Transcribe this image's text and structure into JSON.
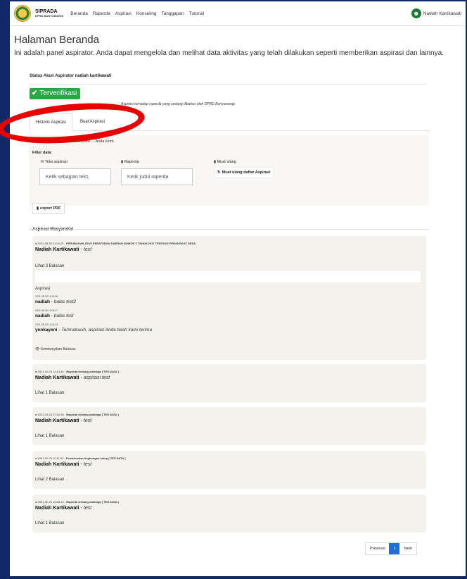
{
  "navbar": {
    "brand_title": "SIPRADA",
    "brand_sub": "DPRD BANYUWANGI",
    "menu": [
      "Beranda",
      "Raperda",
      "Aspirasi",
      "Konseling",
      "Tanggapan",
      "Tutorial"
    ],
    "user_name": "Nadiah Kartikawati"
  },
  "page": {
    "title": "Halaman Beranda",
    "description": "Ini adalah panel aspirator. Anda dapat mengelola dan melihat data aktivitas yang telah dilakukan seperti memberikan aspirasi dan lainnya."
  },
  "status": {
    "line": "Status Akun Aspirator nadiah kartikawati",
    "badge": "Terverifikasi",
    "note": "Aspirasi terhadap raperda yang sedang dibahas oleh DPRD Banyuwangi."
  },
  "tabs": [
    "Historis Aspirasi",
    "Buat Aspirasi"
  ],
  "filter": {
    "info": "ℹ Anda dapat mengelola informasi ... Anda kirim.",
    "title": "Filter data:",
    "text_label": "Teks aspirasi",
    "text_placeholder": "Ketik sebagian teks",
    "raperda_label": "Raperda",
    "raperda_placeholder": "Ketik judul raperda",
    "reload_label": "Muat ulang",
    "reload_button": "Muat ulang daftar Aspirasi"
  },
  "export_label": "export PDF",
  "list_title": "Aspirasi Masyarakat",
  "aspirations": [
    {
      "date": "2021-08-30 11:04:23",
      "topic": "PERUBAHAN ATAS PERATURAN DAERAH NOMOR 3 TAHUN 2017 TENTANG PERANGKAT DESA",
      "name": "Nadiah Kartikawati",
      "text": "test",
      "replies_link": "Lihat 3 Balasan"
    },
    {
      "date": "2021-04-29 14:14:40",
      "topic": "Raperda tentang olahraga [ TES DATA ]",
      "name": "Nadiah Kartikawati",
      "text": "aspirasi test",
      "replies_link": "Lihat 1 Balasan"
    },
    {
      "date": "2021-03-24 07:54:36",
      "topic": "Raperda tentang olahraga [ TES DATA ]",
      "name": "Nadiah Kartikawati",
      "text": "test",
      "replies_link": "Lihat 1 Balasan"
    },
    {
      "date": "2021-02-25 10:11:52",
      "topic": "Pembenahan lingkungan hidup [ TES DATA ]",
      "name": "Nadiah Kartikawati",
      "text": "test",
      "replies_link": "Lihat 2 Balasan"
    },
    {
      "date": "2021-02-25 10:08:14",
      "topic": "Raperda tentang olahraga [ TES DATA ]",
      "name": "Nadiah Kartikawati",
      "text": "test",
      "replies_link": "Lihat 1 Balasan"
    }
  ],
  "replies": {
    "title": "Aspirasi",
    "items": [
      {
        "date": "2021-08-30 11:06:08",
        "name": "nadiah",
        "text": "balas test2"
      },
      {
        "date": "2021-08-30 11:05:17",
        "name": "nadiah",
        "text": "balas test"
      },
      {
        "date": "2021-08-30 11:04:23",
        "name": "yenkayeni",
        "text": "Terimakasih, aspirasi Anda telah kami terima"
      }
    ],
    "hide_label": "Sembunyikan Balasan"
  },
  "pagination": {
    "previous": "Previous",
    "current": "1",
    "next": "Next"
  },
  "colors": {
    "verified": "#28a745",
    "highlight": "#e60000",
    "page_active": "#1f6fd6"
  }
}
